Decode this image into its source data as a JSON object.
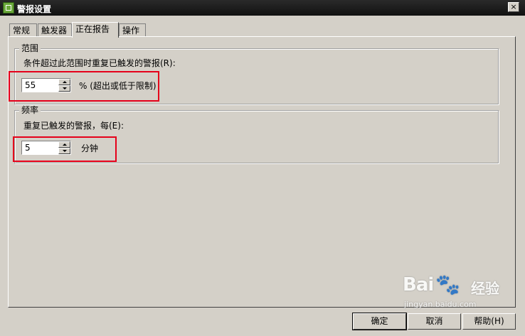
{
  "window": {
    "title": "警报设置",
    "close_glyph": "×"
  },
  "tabs": [
    {
      "label": "常规"
    },
    {
      "label": "触发器"
    },
    {
      "label": "正在报告",
      "active": true
    },
    {
      "label": "操作"
    }
  ],
  "range_group": {
    "legend": "范围",
    "description": "条件超过此范围时重复已触发的警报(R):",
    "value": "55",
    "unit": "% (超出或低于限制)"
  },
  "frequency_group": {
    "legend": "频率",
    "description": "重复已触发的警报，每(E):",
    "value": "5",
    "unit": "分钟"
  },
  "buttons": {
    "ok": "确定",
    "cancel": "取消",
    "help": "帮助(H)"
  },
  "watermark": {
    "logo_text": "Bai",
    "paw": "🐾",
    "brand": "经验",
    "url": "jingyan.baidu.com"
  },
  "colors": {
    "highlight": "#e5001a",
    "titlebar": "#1a1a1a",
    "dialog_bg": "#d4d0c8"
  }
}
